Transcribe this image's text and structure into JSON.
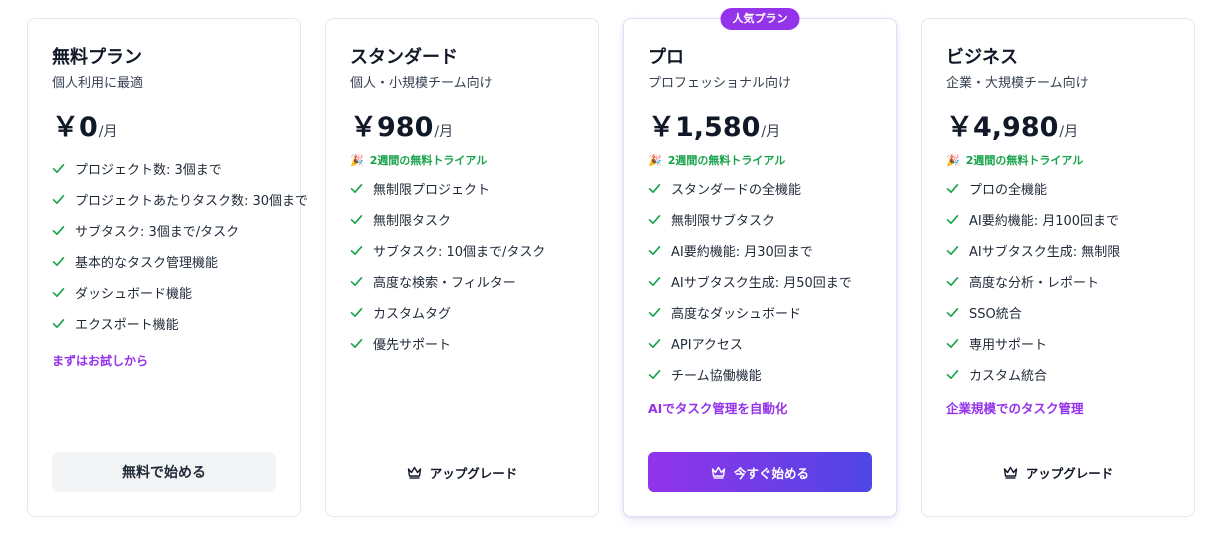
{
  "colors": {
    "accent_purple": "#9333ea",
    "accent_indigo": "#4f46e5",
    "check_green": "#16a34a",
    "trial_green": "#16a34a",
    "border": "#e5e7eb"
  },
  "plans": [
    {
      "id": "free",
      "name": "無料プラン",
      "description": "個人利用に最適",
      "currency": "￥",
      "price": "0",
      "unit": "/月",
      "features": [
        "プロジェクト数: 3個まで",
        "プロジェクトあたりタスク数: 30個まで",
        "サブタスク: 3個まで/タスク",
        "基本的なタスク管理機能",
        "ダッシュボード機能",
        "エクスポート機能"
      ],
      "tagline": "まずはお試しから",
      "cta": {
        "label": "無料で始める",
        "style": "gray",
        "icon": ""
      }
    },
    {
      "id": "standard",
      "name": "スタンダード",
      "description": "個人・小規模チーム向け",
      "currency": "￥",
      "price": "980",
      "unit": "/月",
      "trial": {
        "icon": "party-popper-icon",
        "text": "2週間の無料トライアル"
      },
      "features": [
        "無制限プロジェクト",
        "無制限タスク",
        "サブタスク: 10個まで/タスク",
        "高度な検索・フィルター",
        "カスタムタグ",
        "優先サポート"
      ],
      "cta": {
        "label": "アップグレード",
        "style": "ghost",
        "icon": "crown-icon"
      }
    },
    {
      "id": "pro",
      "name": "プロ",
      "badge": "人気プラン",
      "description": "プロフェッショナル向け",
      "currency": "￥",
      "price": "1,580",
      "unit": "/月",
      "trial": {
        "icon": "party-popper-icon",
        "text": "2週間の無料トライアル"
      },
      "features": [
        "スタンダードの全機能",
        "無制限サブタスク",
        "AI要約機能: 月30回まで",
        "AIサブタスク生成: 月50回まで",
        "高度なダッシュボード",
        "APIアクセス",
        "チーム協働機能"
      ],
      "tagline": "AIでタスク管理を自動化",
      "cta": {
        "label": "今すぐ始める",
        "style": "gradient",
        "icon": "crown-icon"
      }
    },
    {
      "id": "business",
      "name": "ビジネス",
      "description": "企業・大規模チーム向け",
      "currency": "￥",
      "price": "4,980",
      "unit": "/月",
      "trial": {
        "icon": "party-popper-icon",
        "text": "2週間の無料トライアル"
      },
      "features": [
        "プロの全機能",
        "AI要約機能: 月100回まで",
        "AIサブタスク生成: 無制限",
        "高度な分析・レポート",
        "SSO統合",
        "専用サポート",
        "カスタム統合"
      ],
      "tagline": "企業規模でのタスク管理",
      "cta": {
        "label": "アップグレード",
        "style": "ghost",
        "icon": "crown-icon"
      }
    }
  ]
}
